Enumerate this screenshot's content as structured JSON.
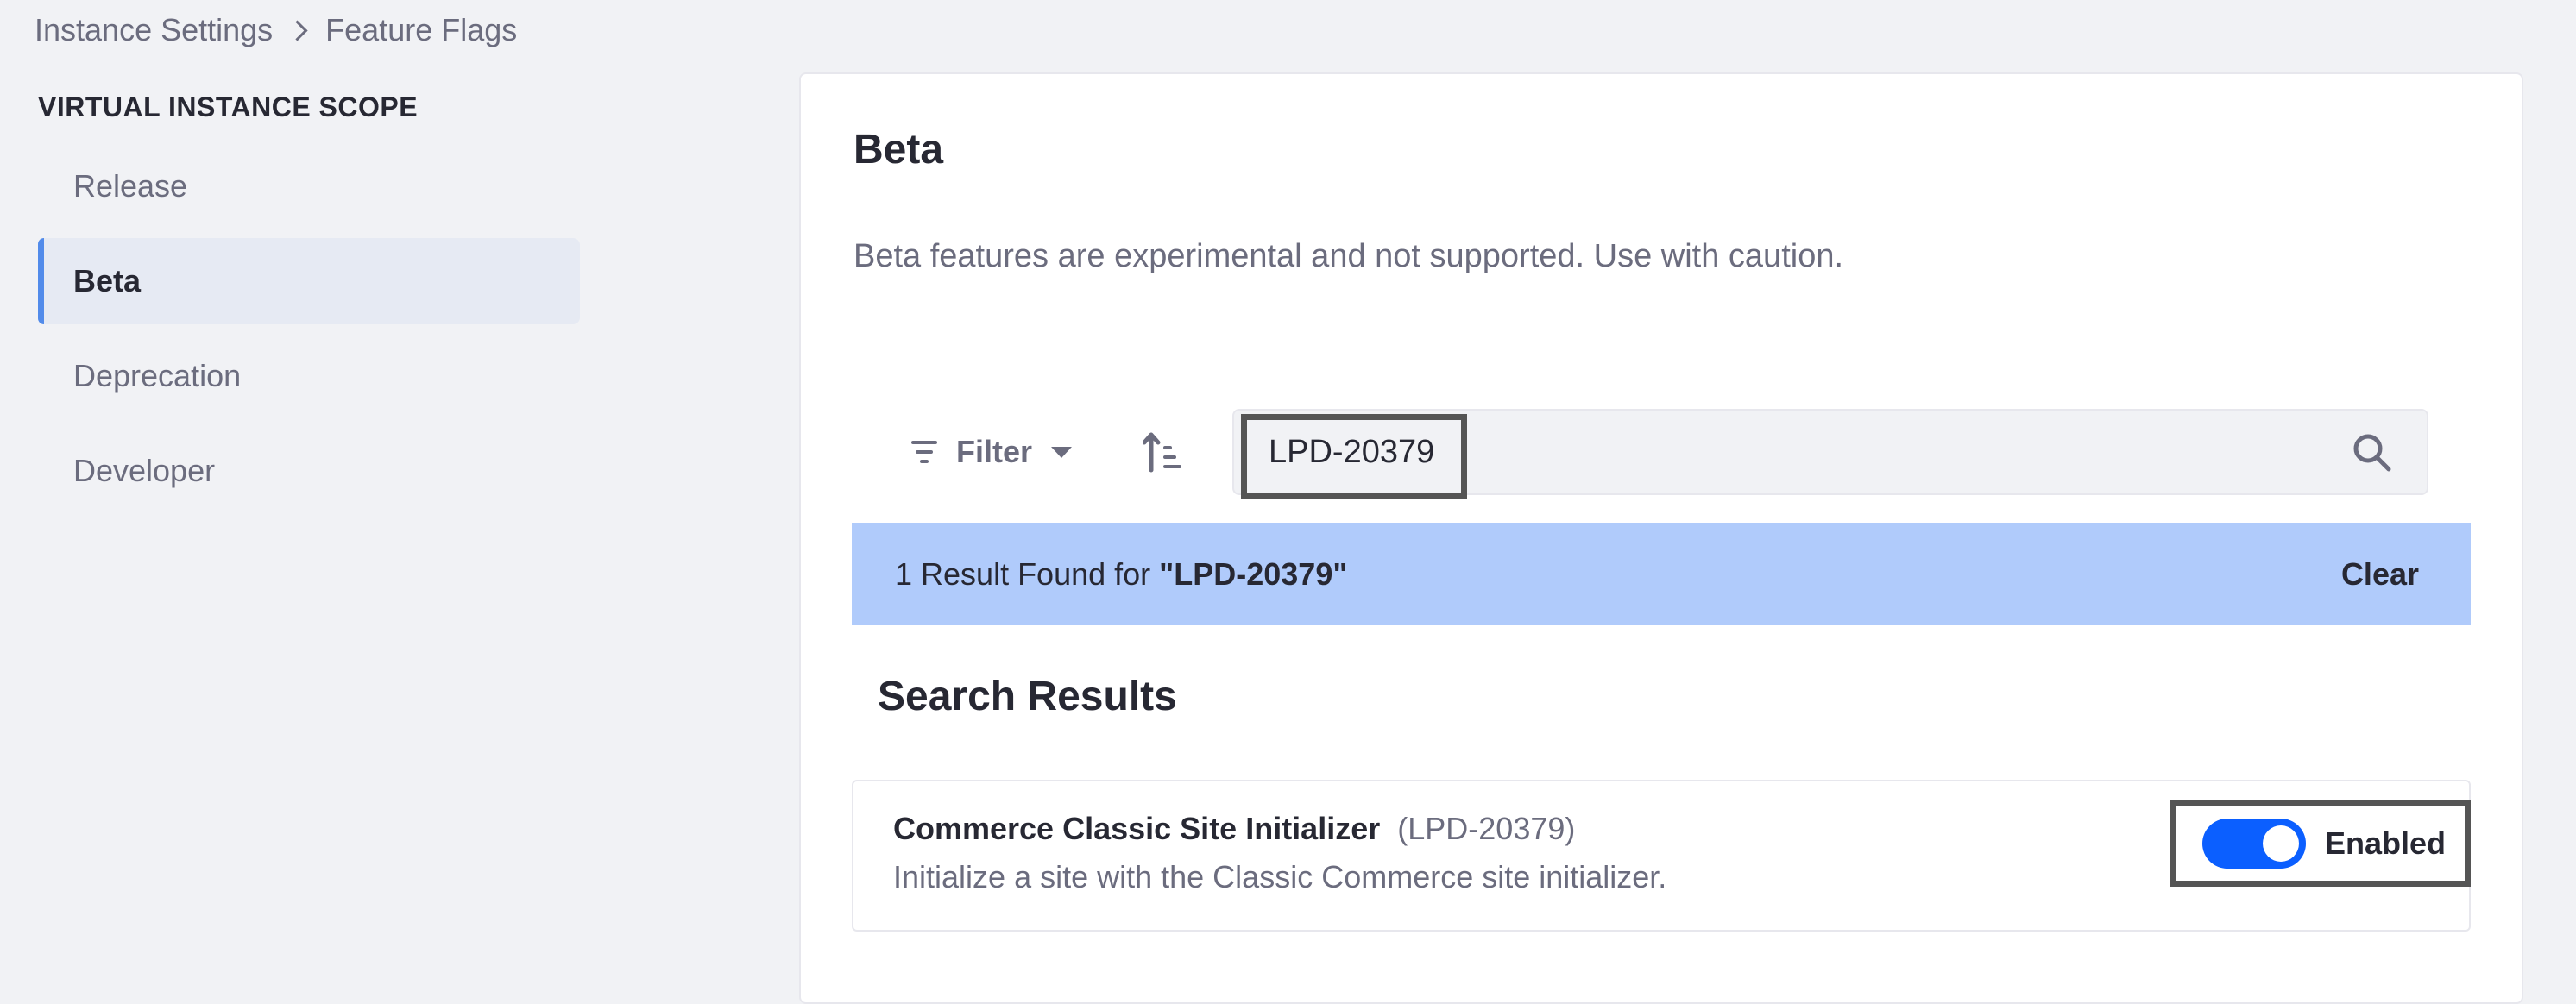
{
  "breadcrumb": {
    "parent": "Instance Settings",
    "current": "Feature Flags"
  },
  "sidebar": {
    "scope_title": "VIRTUAL INSTANCE SCOPE",
    "items": [
      {
        "label": "Release",
        "active": false
      },
      {
        "label": "Beta",
        "active": true
      },
      {
        "label": "Deprecation",
        "active": false
      },
      {
        "label": "Developer",
        "active": false
      }
    ]
  },
  "main": {
    "title": "Beta",
    "description": "Beta features are experimental and not supported. Use with caution."
  },
  "toolbar": {
    "filter_label": "Filter",
    "filter_icon": "filter-icon",
    "sort_icon": "sort-order-icon",
    "search": {
      "value": "LPD-20379",
      "placeholder": "",
      "icon": "search-icon"
    }
  },
  "result_banner": {
    "prefix": "1 Result Found for ",
    "term": "\"LPD-20379\"",
    "clear_label": "Clear"
  },
  "results": {
    "section_title": "Search Results",
    "items": [
      {
        "name": "Commerce Classic Site Initializer",
        "key": "(LPD-20379)",
        "description": "Initialize a site with the Classic Commerce site initializer.",
        "toggle_state": "Enabled",
        "enabled": true
      }
    ]
  },
  "colors": {
    "accent": "#528bea",
    "toggle_on": "#0b5fff",
    "banner": "#b0cbfb",
    "background": "#f1f2f5"
  }
}
